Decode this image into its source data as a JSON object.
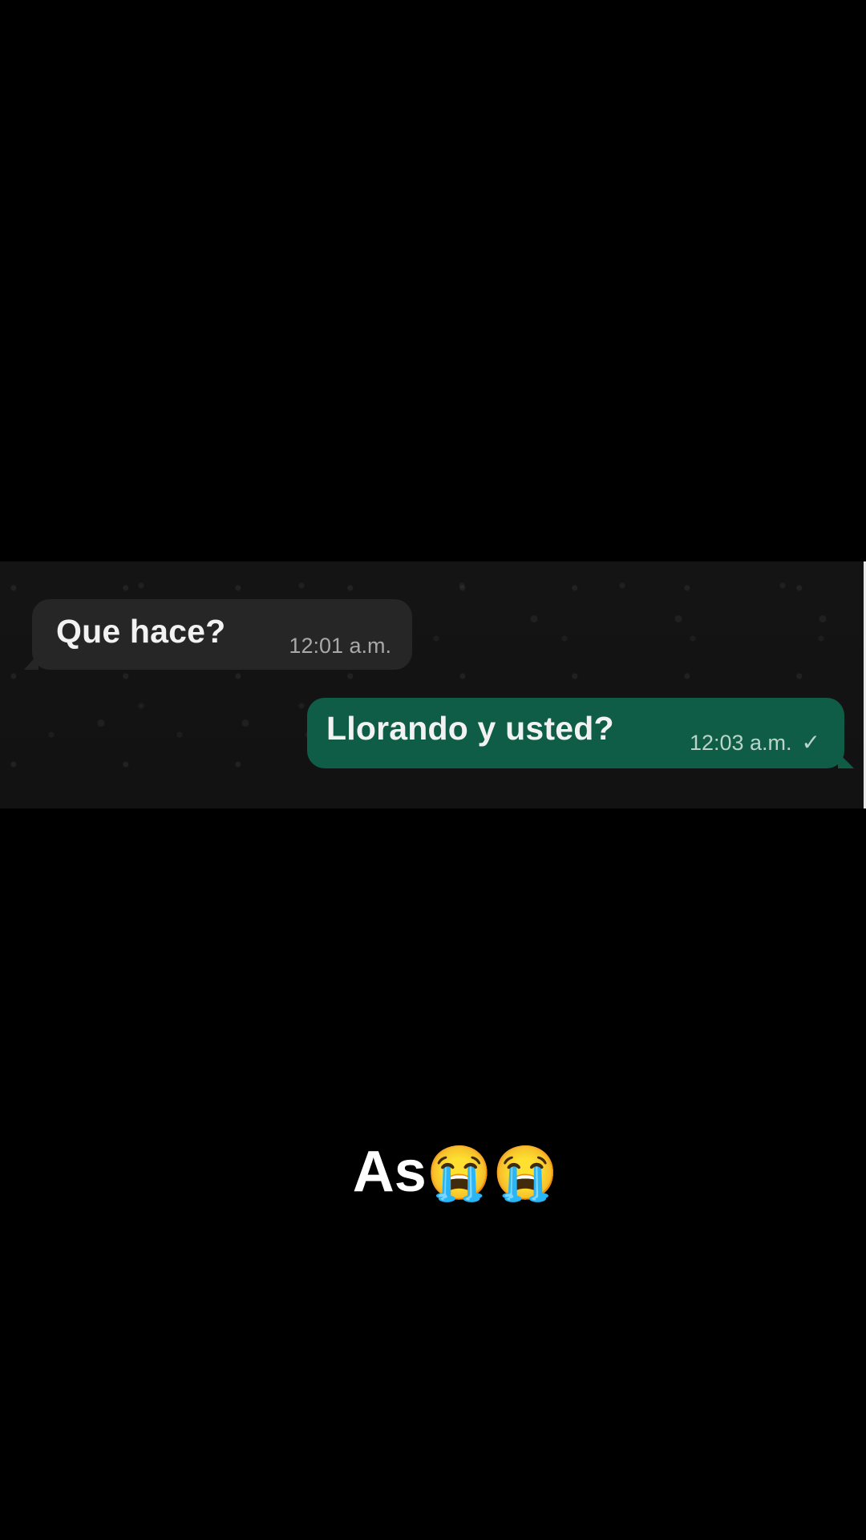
{
  "chat": {
    "incoming": {
      "text": "Que hace?",
      "time": "12:01 a.m."
    },
    "outgoing": {
      "text": "Llorando y usted?",
      "time": "12:03 a.m.",
      "status_icon": "single-check-icon"
    }
  },
  "caption": {
    "text": "As",
    "emoji": "😭😭"
  },
  "colors": {
    "background": "#000000",
    "incoming_bubble": "#262626",
    "outgoing_bubble": "#0f5d46"
  }
}
